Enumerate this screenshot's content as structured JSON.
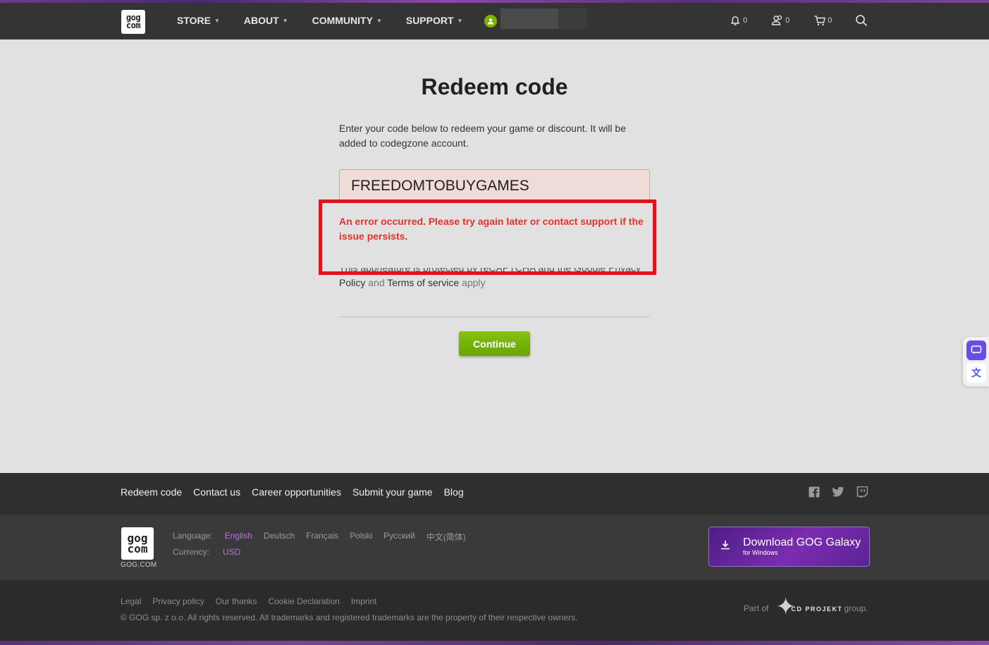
{
  "header": {
    "logo_line1": "gog",
    "logo_line2": "com",
    "nav": [
      {
        "label": "STORE"
      },
      {
        "label": "ABOUT"
      },
      {
        "label": "COMMUNITY"
      },
      {
        "label": "SUPPORT"
      }
    ],
    "notifications_count": "0",
    "friends_count": "0",
    "cart_count": "0"
  },
  "main": {
    "title": "Redeem code",
    "intro": "Enter your code below to redeem your game or discount. It will be added to codegzone account.",
    "code_value": "FREEDOMTOBUYGAMES",
    "error": "An error occurred. Please try again later or contact support if the issue persists.",
    "recaptcha_cut": "This app/feature is protected by reCAPTCHA and the Google Privacy",
    "recaptcha_policy": "Policy",
    "recaptcha_and": "and",
    "recaptcha_terms": "Terms of service",
    "recaptcha_apply": "apply",
    "continue_label": "Continue"
  },
  "footer": {
    "links": [
      "Redeem code",
      "Contact us",
      "Career opportunities",
      "Submit your game",
      "Blog"
    ],
    "logo_caption": "GOG.COM",
    "language_label": "Language:",
    "languages": [
      "English",
      "Deutsch",
      "Français",
      "Polski",
      "Русский",
      "中文(简体)"
    ],
    "selected_language": "English",
    "currency_label": "Currency:",
    "currency": "USD",
    "galaxy_title": "Download GOG Galaxy",
    "galaxy_sub": "for Windows",
    "legal": [
      "Legal",
      "Privacy policy",
      "Our thanks",
      "Cookie Declaration",
      "Imprint"
    ],
    "copyright": "© GOG sp. z o.o. All rights reserved. All trademarks and registered trademarks are the property of their respective owners.",
    "part_of": "Part of",
    "cdp_name": "CD PROJEKT",
    "group": "group."
  },
  "colors": {
    "topbar": "#343434",
    "accent_green": "#7cb400",
    "error_red": "#e0322e",
    "annotation_red": "#e3131e",
    "language_selected": "#b972e0"
  }
}
